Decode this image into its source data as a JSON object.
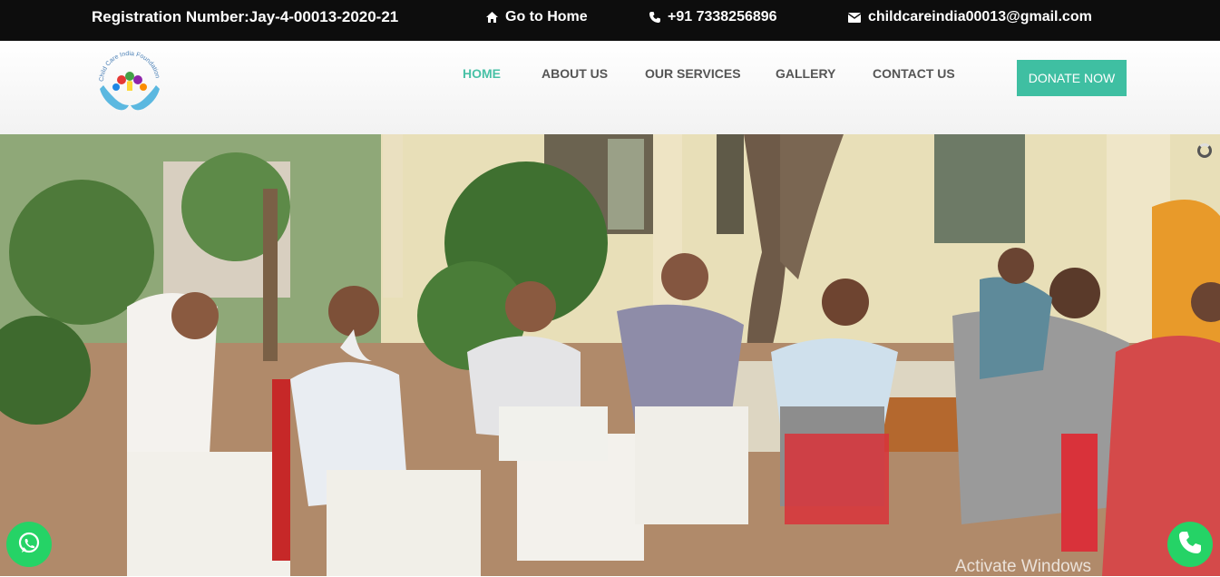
{
  "topbar": {
    "registration": "Registration Number:Jay-4-00013-2020-21",
    "home_link": "Go to Home",
    "phone": "+91 7338256896",
    "email": "childcareindia00013@gmail.com"
  },
  "logo": {
    "text": "Child Care India Foundation"
  },
  "nav": {
    "items": [
      {
        "label": "HOME",
        "active": true
      },
      {
        "label": "ABOUT US",
        "active": false
      },
      {
        "label": "OUR SERVICES",
        "active": false
      },
      {
        "label": "GALLERY",
        "active": false
      },
      {
        "label": "CONTACT US",
        "active": false
      }
    ],
    "donate": "DONATE NOW"
  },
  "colors": {
    "accent": "#48c1a6",
    "topbar": "#0d0d0d",
    "whatsapp": "#25d366"
  },
  "icons": {
    "home": "home-icon",
    "phone": "phone-icon",
    "email": "envelope-icon",
    "whatsapp": "whatsapp-icon",
    "call": "call-icon"
  },
  "overlay": {
    "watermark": "Activate Windows"
  }
}
